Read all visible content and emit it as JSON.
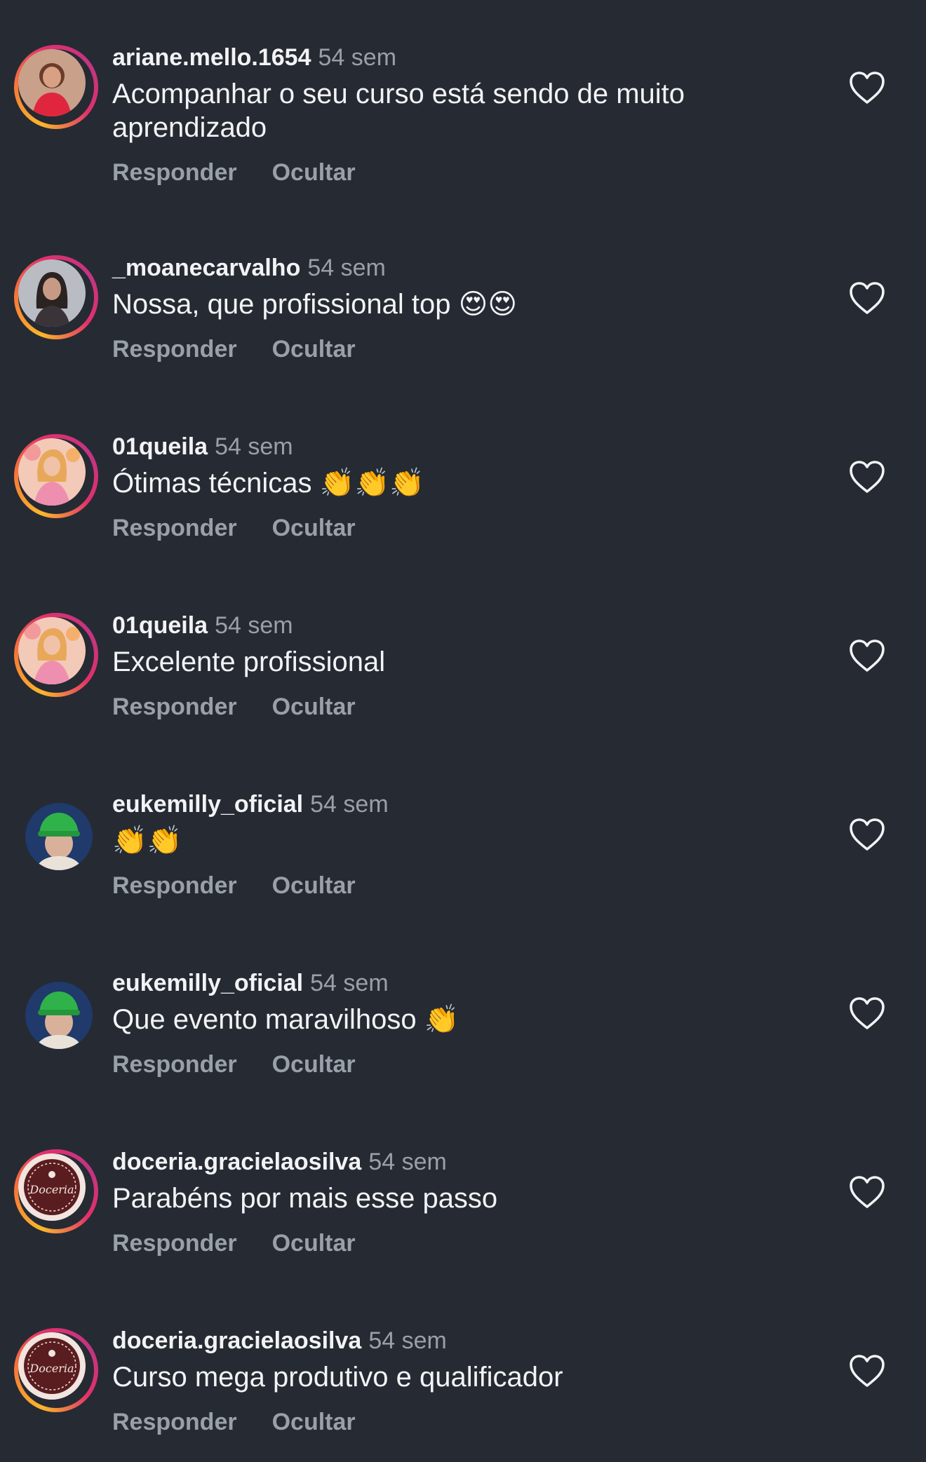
{
  "colors": {
    "background": "#262a33",
    "primary_text": "#f2f3f5",
    "secondary_text": "#9aa0aa"
  },
  "comments": [
    {
      "username": "ariane.mello.1654",
      "time": "54 sem",
      "text": "Acompanhar o seu curso está sendo de muito\naprendizado",
      "reply_label": "Responder",
      "hide_label": "Ocultar",
      "story_ring": true,
      "avatar_icon": "user-photo-red",
      "like_icon": "heart-outline-icon"
    },
    {
      "username": "_moanecarvalho",
      "time": "54 sem",
      "text": "Nossa, que profissional top 😍😍",
      "reply_label": "Responder",
      "hide_label": "Ocultar",
      "story_ring": true,
      "avatar_icon": "user-photo-gray",
      "like_icon": "heart-outline-icon"
    },
    {
      "username": "01queila",
      "time": "54 sem",
      "text": "Ótimas técnicas 👏👏👏",
      "reply_label": "Responder",
      "hide_label": "Ocultar",
      "story_ring": true,
      "avatar_icon": "user-photo-pink",
      "like_icon": "heart-outline-icon"
    },
    {
      "username": "01queila",
      "time": "54 sem",
      "text": "Excelente profissional",
      "reply_label": "Responder",
      "hide_label": "Ocultar",
      "story_ring": true,
      "avatar_icon": "user-photo-pink",
      "like_icon": "heart-outline-icon"
    },
    {
      "username": "eukemilly_oficial",
      "time": "54 sem",
      "text": "👏👏",
      "reply_label": "Responder",
      "hide_label": "Ocultar",
      "story_ring": false,
      "avatar_icon": "user-photo-green-hat",
      "like_icon": "heart-outline-icon"
    },
    {
      "username": "eukemilly_oficial",
      "time": "54 sem",
      "text": "Que evento maravilhoso 👏",
      "reply_label": "Responder",
      "hide_label": "Ocultar",
      "story_ring": false,
      "avatar_icon": "user-photo-green-hat",
      "like_icon": "heart-outline-icon"
    },
    {
      "username": "doceria.gracielaosilva",
      "time": "54 sem",
      "text": "Parabéns por mais esse passo",
      "reply_label": "Responder",
      "hide_label": "Ocultar",
      "story_ring": true,
      "avatar_icon": "doceria-logo",
      "avatar_logo_text": "Doceria",
      "like_icon": "heart-outline-icon"
    },
    {
      "username": "doceria.gracielaosilva",
      "time": "54 sem",
      "text": "Curso mega produtivo e qualificador",
      "reply_label": "Responder",
      "hide_label": "Ocultar",
      "story_ring": true,
      "avatar_icon": "doceria-logo",
      "avatar_logo_text": "Doceria",
      "like_icon": "heart-outline-icon"
    }
  ]
}
